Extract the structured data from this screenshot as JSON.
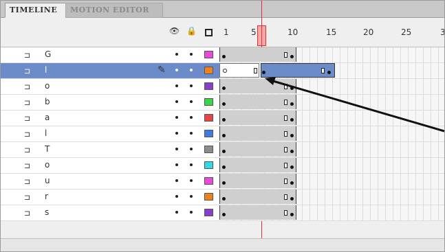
{
  "tabs": [
    {
      "label": "TIMELINE"
    },
    {
      "label": "MOTION EDITOR"
    }
  ],
  "header_icons": [
    "eye-icon",
    "lock-icon",
    "outline-icon"
  ],
  "ruler": {
    "labels": [
      "1",
      "5",
      "10",
      "15",
      "20",
      "25",
      "3"
    ]
  },
  "layers": [
    {
      "name": "G",
      "color": "#e84bd8",
      "selected": false
    },
    {
      "name": "l",
      "color": "#f0821e",
      "selected": true
    },
    {
      "name": "o",
      "color": "#8b3fc8",
      "selected": false
    },
    {
      "name": "b",
      "color": "#39d64b",
      "selected": false
    },
    {
      "name": "a",
      "color": "#e64545",
      "selected": false
    },
    {
      "name": "l",
      "color": "#3f7be0",
      "selected": false
    },
    {
      "name": "T",
      "color": "#8c8c8c",
      "selected": false
    },
    {
      "name": "o",
      "color": "#33d9e6",
      "selected": false
    },
    {
      "name": "u",
      "color": "#e84bd8",
      "selected": false
    },
    {
      "name": "r",
      "color": "#f0821e",
      "selected": false
    },
    {
      "name": "s",
      "color": "#8b3fc8",
      "selected": false
    }
  ],
  "playhead": {
    "frame": 6
  }
}
